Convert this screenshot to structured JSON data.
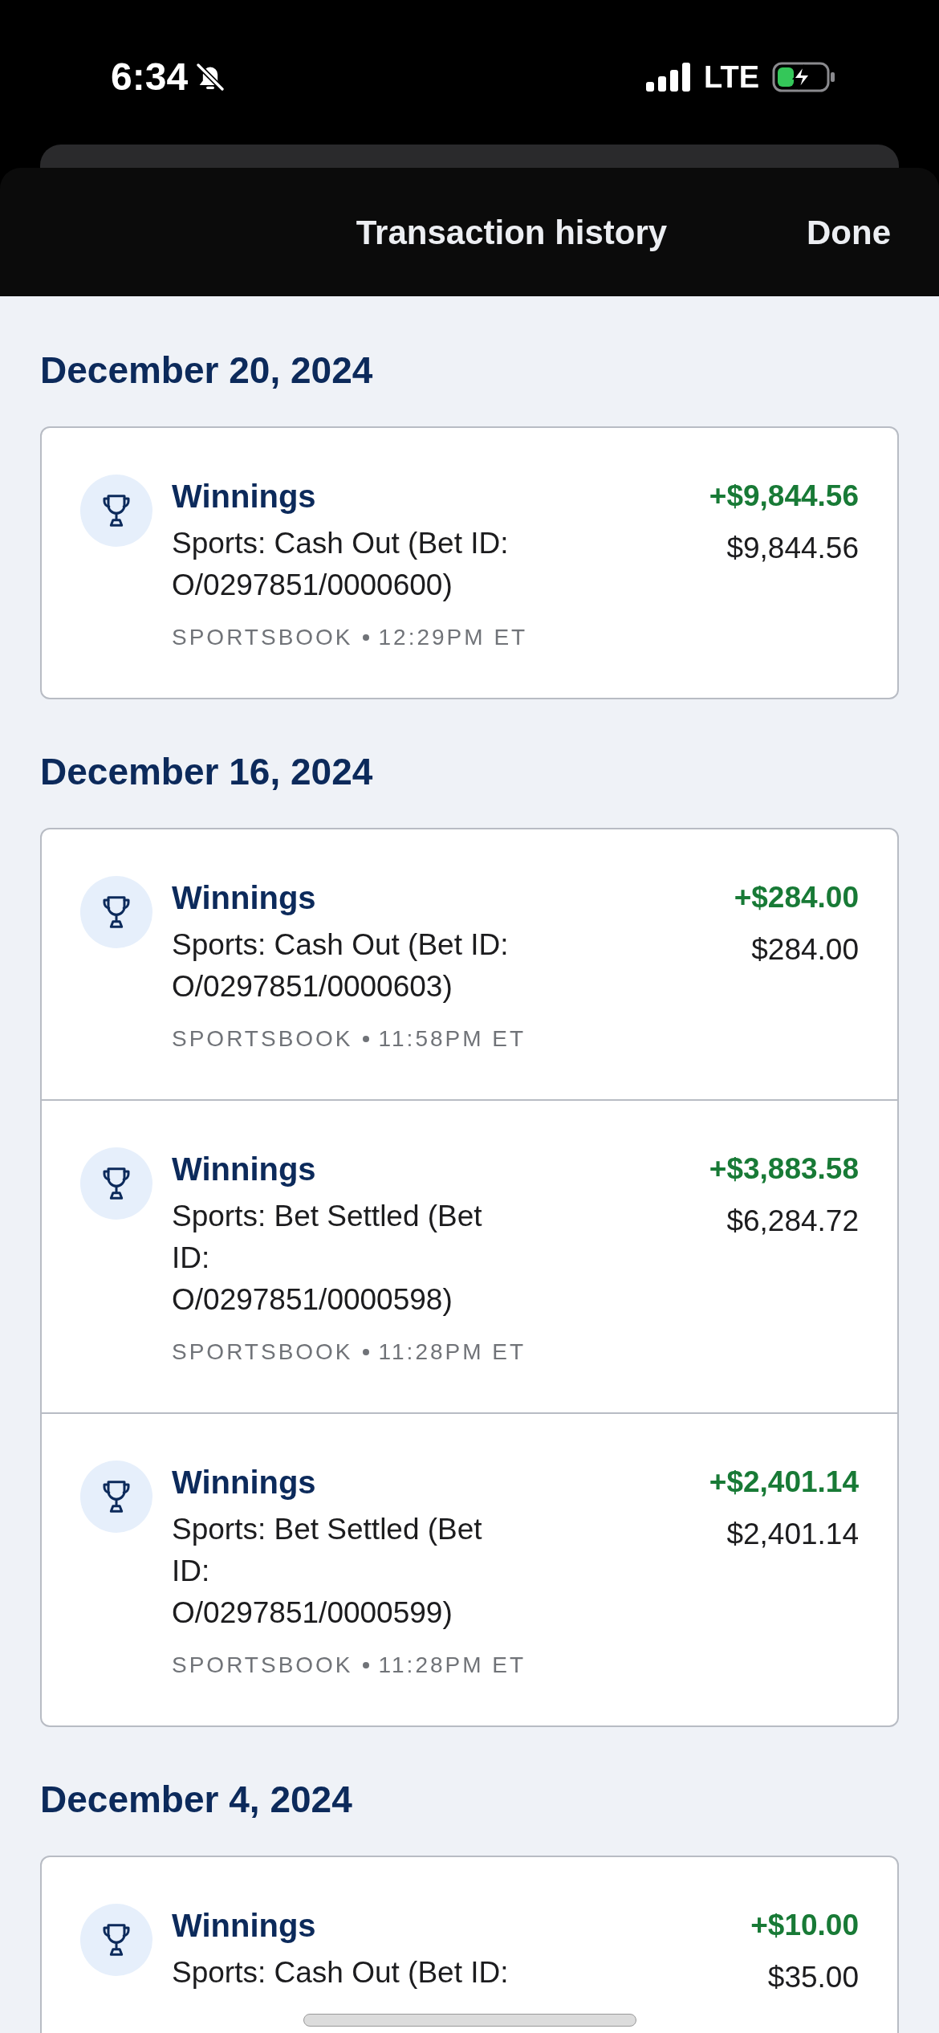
{
  "status_bar": {
    "time": "6:34",
    "network": "LTE"
  },
  "header": {
    "title": "Transaction history",
    "done": "Done"
  },
  "groups": [
    {
      "date": "December 20, 2024",
      "items": [
        {
          "title": "Winnings",
          "description_lines": [
            "Sports: Cash Out (Bet ID:",
            "O/0297851/0000600)"
          ],
          "source": "SPORTSBOOK",
          "time": "12:29PM ET",
          "amount": "+$9,844.56",
          "balance": "$9,844.56"
        }
      ]
    },
    {
      "date": "December 16, 2024",
      "items": [
        {
          "title": "Winnings",
          "description_lines": [
            "Sports: Cash Out (Bet ID:",
            "O/0297851/0000603)"
          ],
          "source": "SPORTSBOOK",
          "time": "11:58PM ET",
          "amount": "+$284.00",
          "balance": "$284.00"
        },
        {
          "title": "Winnings",
          "description_lines": [
            "Sports: Bet Settled (Bet",
            "ID:",
            "O/0297851/0000598)"
          ],
          "source": "SPORTSBOOK",
          "time": "11:28PM ET",
          "amount": "+$3,883.58",
          "balance": "$6,284.72"
        },
        {
          "title": "Winnings",
          "description_lines": [
            "Sports: Bet Settled (Bet",
            "ID:",
            "O/0297851/0000599)"
          ],
          "source": "SPORTSBOOK",
          "time": "11:28PM ET",
          "amount": "+$2,401.14",
          "balance": "$2,401.14"
        }
      ]
    },
    {
      "date": "December 4, 2024",
      "items": [
        {
          "title": "Winnings",
          "description_lines": [
            "Sports: Cash Out (Bet ID:"
          ],
          "amount": "+$10.00",
          "balance": "$35.00"
        }
      ]
    }
  ]
}
